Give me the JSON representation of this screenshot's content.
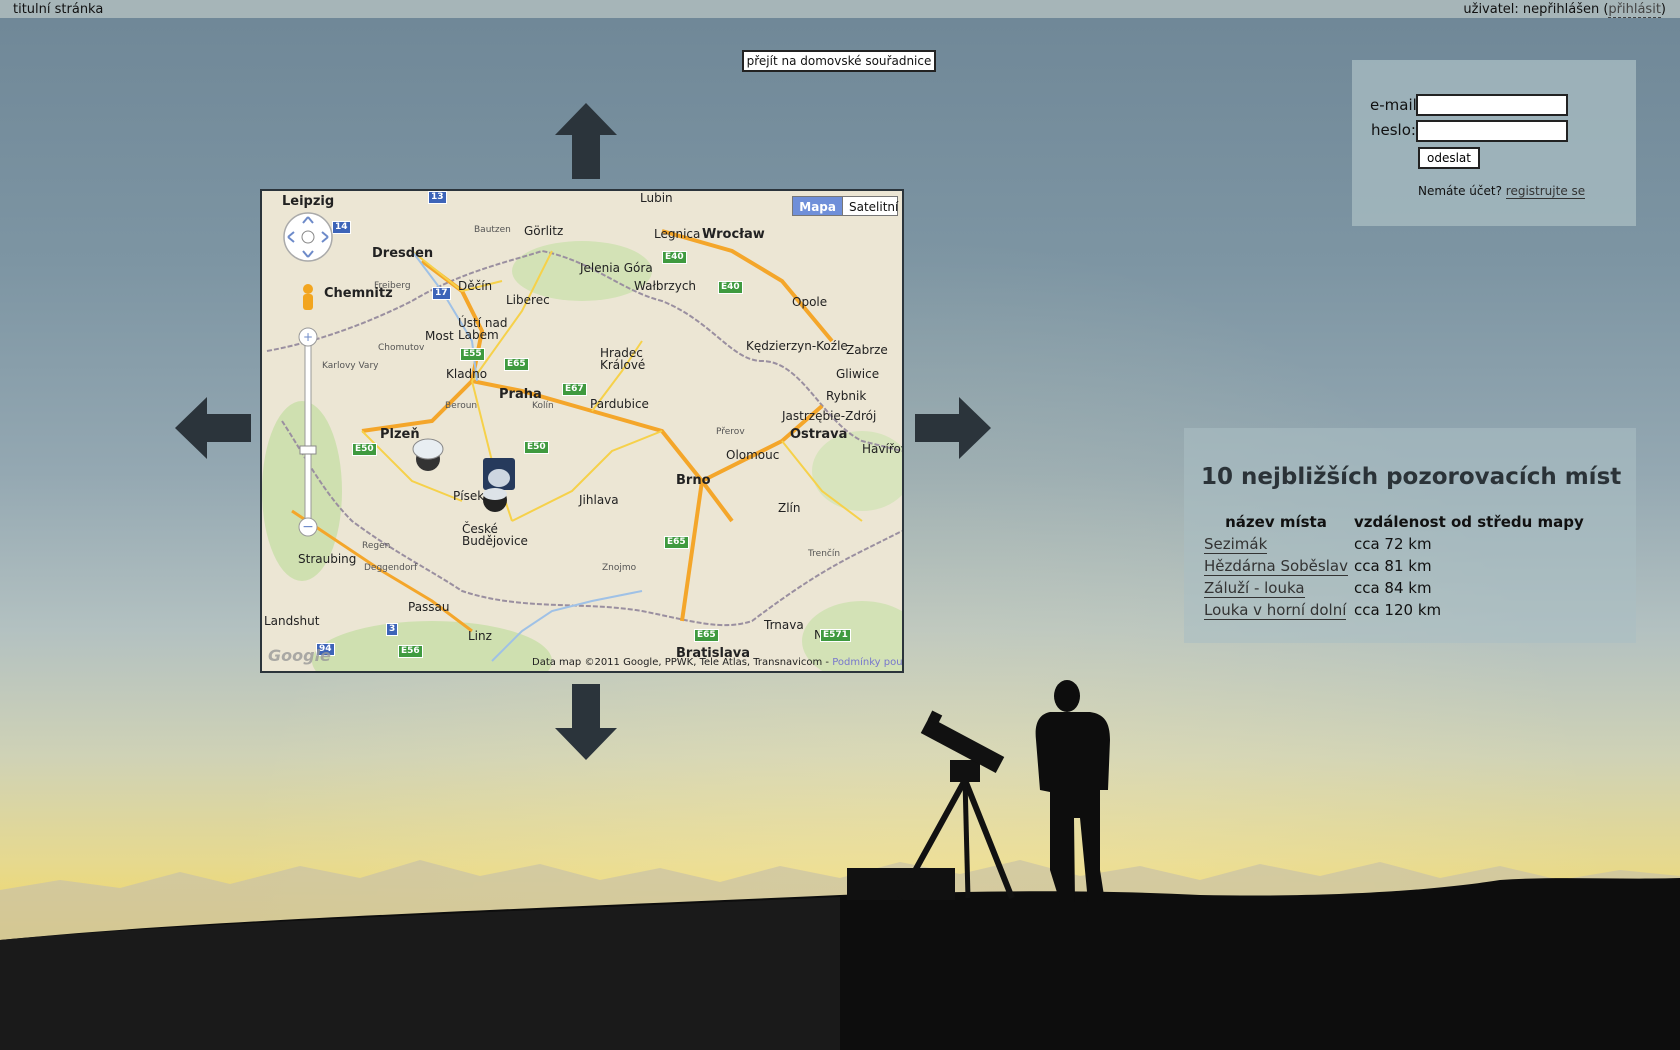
{
  "topbar": {
    "home_link": "titulní stránka",
    "user_label": "uživatel: nepřihlášen (",
    "login_link": "přihlásit",
    "user_suffix": ")"
  },
  "home_coords_button": "přejít na domovské souřadnice",
  "map": {
    "map_type_map": "Mapa",
    "map_type_satellite": "Satelitní",
    "copyright": "Data map ©2011 Google, PPWK, Tele Atlas, Transnavicom - ",
    "terms": "Podmínky použití",
    "google_logo": "Google",
    "cities": [
      {
        "name": "Leipzig",
        "cls": "big"
      },
      {
        "name": "Dresden",
        "cls": "big"
      },
      {
        "name": "Chemnitz",
        "cls": "big"
      },
      {
        "name": "Görlitz",
        "cls": ""
      },
      {
        "name": "Lubin",
        "cls": ""
      },
      {
        "name": "Wrocław",
        "cls": "big"
      },
      {
        "name": "Legnica",
        "cls": ""
      },
      {
        "name": "Jelenia Góra",
        "cls": ""
      },
      {
        "name": "Wałbrzych",
        "cls": ""
      },
      {
        "name": "Liberec",
        "cls": ""
      },
      {
        "name": "Děčín",
        "cls": ""
      },
      {
        "name": "Ústí nad Labem",
        "cls": ""
      },
      {
        "name": "Most",
        "cls": ""
      },
      {
        "name": "Opole",
        "cls": ""
      },
      {
        "name": "Kędzierzyn-Koźle",
        "cls": ""
      },
      {
        "name": "Zabrze",
        "cls": ""
      },
      {
        "name": "Gliwice",
        "cls": ""
      },
      {
        "name": "Kladno",
        "cls": ""
      },
      {
        "name": "Praha",
        "cls": "big"
      },
      {
        "name": "Hradec Králové",
        "cls": ""
      },
      {
        "name": "Pardubice",
        "cls": ""
      },
      {
        "name": "Rybnik",
        "cls": ""
      },
      {
        "name": "Jastrzębie-Zdrój",
        "cls": ""
      },
      {
        "name": "Ostrava",
        "cls": "big"
      },
      {
        "name": "Plzeň",
        "cls": "big"
      },
      {
        "name": "Beroun",
        "cls": ""
      },
      {
        "name": "Kolín",
        "cls": ""
      },
      {
        "name": "Jihlava",
        "cls": ""
      },
      {
        "name": "Olomouc",
        "cls": ""
      },
      {
        "name": "Havířov",
        "cls": ""
      },
      {
        "name": "Brno",
        "cls": "big"
      },
      {
        "name": "Zlín",
        "cls": ""
      },
      {
        "name": "Písek",
        "cls": ""
      },
      {
        "name": "České Budějovice",
        "cls": ""
      },
      {
        "name": "Regen",
        "cls": ""
      },
      {
        "name": "Straubing",
        "cls": ""
      },
      {
        "name": "Deggendorf",
        "cls": ""
      },
      {
        "name": "Passau",
        "cls": ""
      },
      {
        "name": "Landshut",
        "cls": ""
      },
      {
        "name": "Linz",
        "cls": ""
      },
      {
        "name": "Trnava",
        "cls": ""
      },
      {
        "name": "Nitra",
        "cls": ""
      },
      {
        "name": "Bratislava",
        "cls": "big"
      },
      {
        "name": "Znojmo",
        "cls": ""
      },
      {
        "name": "Přerov",
        "cls": ""
      },
      {
        "name": "Karlovy Vary",
        "cls": "small"
      },
      {
        "name": "Chomutov",
        "cls": "small"
      },
      {
        "name": "Freiberg",
        "cls": "small"
      },
      {
        "name": "Bautzen",
        "cls": "small"
      },
      {
        "name": "Trenčín",
        "cls": "small"
      }
    ],
    "shields": [
      "13",
      "14",
      "17",
      "E55",
      "E65",
      "E67",
      "E50",
      "E50",
      "E40",
      "E40",
      "E65",
      "E65",
      "E571",
      "E56",
      "3",
      "94"
    ]
  },
  "login": {
    "email_label": "e-mail",
    "password_label": "heslo:",
    "submit": "odeslat",
    "no_account": "Nemáte účet? ",
    "register_link": "registrujte se"
  },
  "nearest": {
    "title": "10 nejbližších pozorovacích míst",
    "col_name": "název místa",
    "col_distance": "vzdálenost od středu mapy",
    "rows": [
      {
        "name": "Sezimák",
        "distance": "cca 72 km"
      },
      {
        "name": "Hězdárna Soběslav",
        "distance": "cca 81 km"
      },
      {
        "name": "Záluží - louka",
        "distance": "cca 84 km"
      },
      {
        "name": "Louka v horní dolní",
        "distance": "cca 120 km"
      }
    ]
  },
  "colors": {
    "arrow": "#2b343b",
    "panel": "#aabec3",
    "map_type_active": "#6f8fd9"
  }
}
